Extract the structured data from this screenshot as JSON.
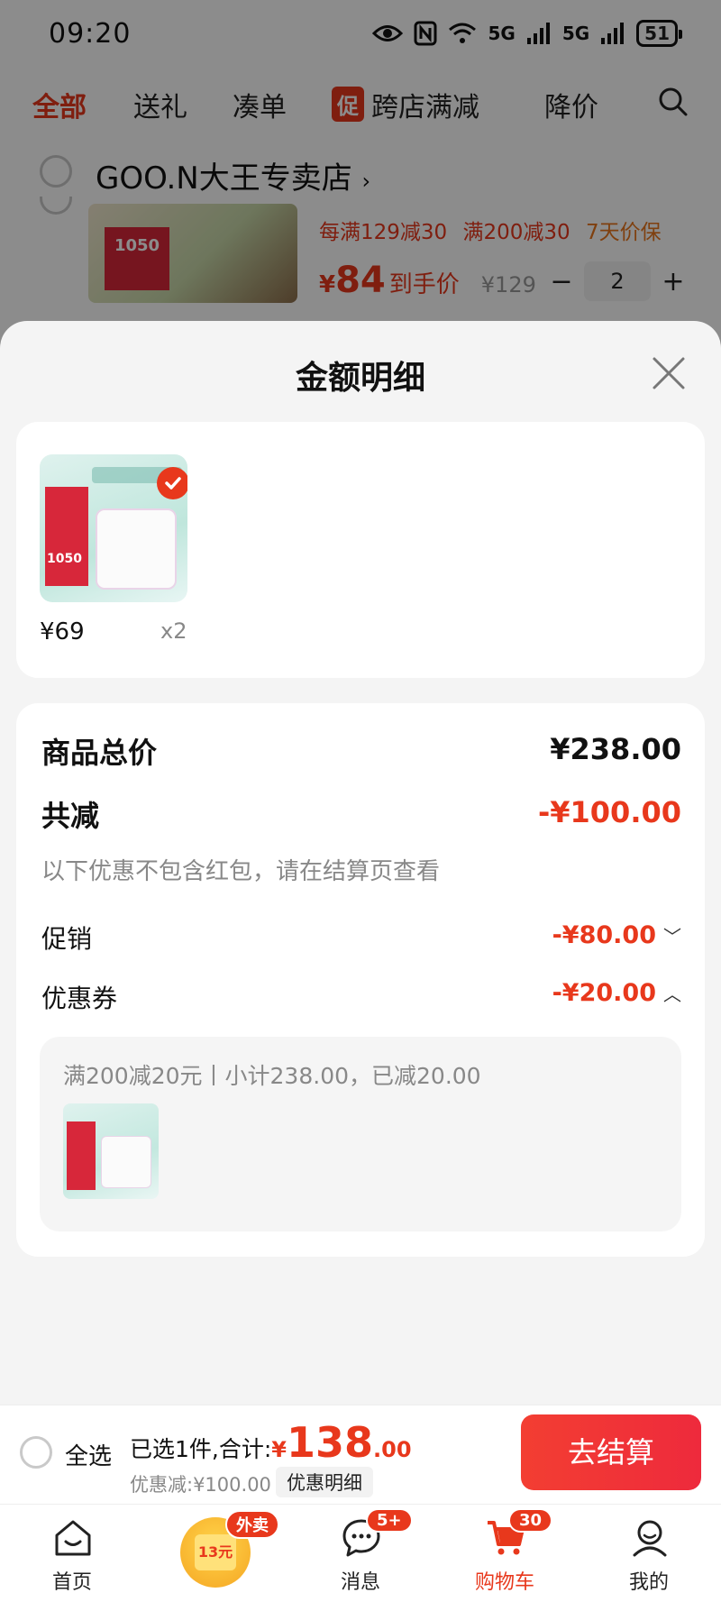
{
  "status_bar": {
    "time": "09:20",
    "network_1": "5G",
    "network_2": "5G",
    "battery": "51"
  },
  "category_tabs": [
    {
      "label": "全部",
      "active": true
    },
    {
      "label": "送礼",
      "active": false
    },
    {
      "label": "凑单",
      "active": false
    },
    {
      "label": "跨店满减",
      "badge": "促",
      "active": false
    },
    {
      "label": "降价",
      "active": false
    }
  ],
  "store": {
    "name": "GOO.N大王专卖店",
    "arrow": "›",
    "thumb_label": "1050",
    "promo_1": "每满129减30",
    "promo_2": "满200减30",
    "promo_3": "7天价保",
    "price_symbol": "¥",
    "price": "84",
    "price_label": "到手价",
    "original_price": "¥129",
    "quantity": "2",
    "minus": "−",
    "plus": "+"
  },
  "sheet": {
    "title": "金额明细",
    "item": {
      "thumb_label": "1050",
      "price": "¥69",
      "qty": "x2"
    },
    "total_label": "商品总价",
    "total_value": "¥238.00",
    "discount_label": "共减",
    "discount_value": "-¥100.00",
    "note": "以下优惠不包含红包，请在结算页查看",
    "promo_label": "促销",
    "promo_value": "-¥80.00",
    "coupon_label": "优惠券",
    "coupon_value": "-¥20.00",
    "coupon_detail": "满200减20元丨小计238.00，已减20.00"
  },
  "settle_bar": {
    "select_all": "全选",
    "selected_text": "已选1件,合计:",
    "yen": "¥",
    "total_int": "138",
    "total_dec": ".00",
    "discount_text": "优惠减:¥100.00",
    "detail_link": "优惠明细",
    "checkout": "去结算"
  },
  "tab_bar": {
    "home": "首页",
    "takeout_badge": "外卖",
    "takeout_coupon": "13元",
    "messages": "消息",
    "messages_badge": "5+",
    "cart": "购物车",
    "cart_badge": "30",
    "mine": "我的"
  },
  "colors": {
    "accent": "#e8381c",
    "checkout_start": "#f33e32",
    "checkout_end": "#ee2a3c"
  }
}
